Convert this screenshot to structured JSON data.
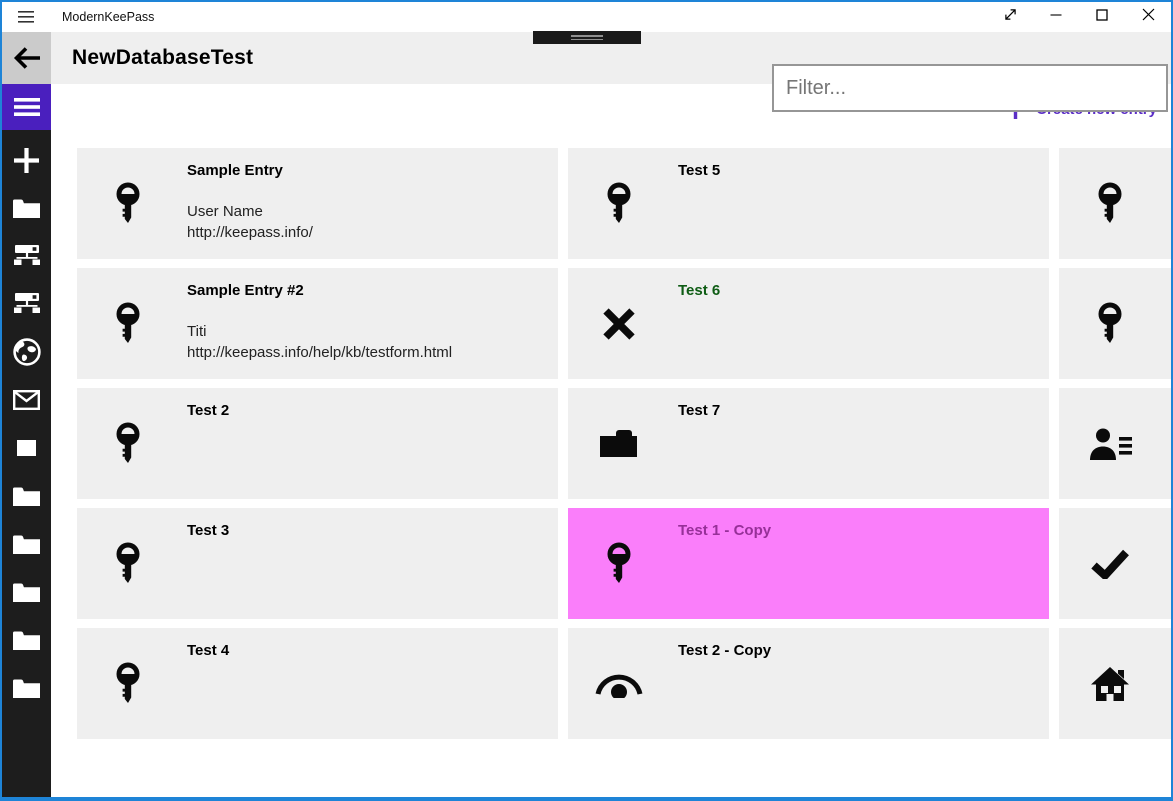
{
  "window": {
    "app_title": "ModernKeePass",
    "border_color": "#1e84d7",
    "controls": [
      {
        "name": "fullscreen"
      },
      {
        "name": "minimize"
      },
      {
        "name": "maximize"
      },
      {
        "name": "close"
      }
    ]
  },
  "header": {
    "title": "NewDatabaseTest",
    "back_icon": "back-arrow",
    "filter_placeholder": "Filter...",
    "filter_value": ""
  },
  "toolbar": {
    "create_label": "Create new entry",
    "accent_color": "#5b2ec6"
  },
  "sidebar": {
    "bg_color": "#1d1d1d",
    "hamburger_bg_color": "#4a1fbe",
    "items": [
      {
        "icon": "menu",
        "accent": true
      },
      {
        "icon": "plus"
      },
      {
        "icon": "folder-side"
      },
      {
        "icon": "network"
      },
      {
        "icon": "network"
      },
      {
        "icon": "globe"
      },
      {
        "icon": "mail"
      },
      {
        "icon": "square"
      },
      {
        "icon": "folder-side"
      },
      {
        "icon": "folder-side"
      },
      {
        "icon": "folder-side"
      },
      {
        "icon": "folder-side"
      },
      {
        "icon": "folder-side"
      }
    ]
  },
  "entry_grid": {
    "card_bg": "#efefef",
    "highlight_bg": "#fa7efa",
    "highlight_title_color": "#963098",
    "entries": [
      {
        "title": "Sample Entry",
        "icon": "key",
        "lines": [
          "User Name",
          "http://keepass.info/"
        ]
      },
      {
        "title": "Test 5",
        "icon": "key",
        "lines": []
      },
      {
        "title": "",
        "icon": "key",
        "lines": []
      },
      {
        "title": "Sample Entry #2",
        "icon": "key",
        "lines": [
          "Titi",
          "http://keepass.info/help/kb/testform.html"
        ]
      },
      {
        "title": "Test 6",
        "icon": "cross",
        "lines": [],
        "title_color": "#0e5c14"
      },
      {
        "title": "",
        "icon": "key",
        "lines": []
      },
      {
        "title": "Test 2",
        "icon": "key",
        "lines": []
      },
      {
        "title": "Test 7",
        "icon": "folder",
        "lines": []
      },
      {
        "title": "",
        "icon": "contact",
        "lines": []
      },
      {
        "title": "Test 3",
        "icon": "key",
        "lines": []
      },
      {
        "title": "Test 1 - Copy",
        "icon": "key",
        "lines": [],
        "highlight": true
      },
      {
        "title": "",
        "icon": "check",
        "lines": []
      },
      {
        "title": "Test 4",
        "icon": "key",
        "lines": []
      },
      {
        "title": "Test 2 - Copy",
        "icon": "view",
        "lines": []
      },
      {
        "title": "",
        "icon": "home",
        "lines": []
      }
    ]
  }
}
